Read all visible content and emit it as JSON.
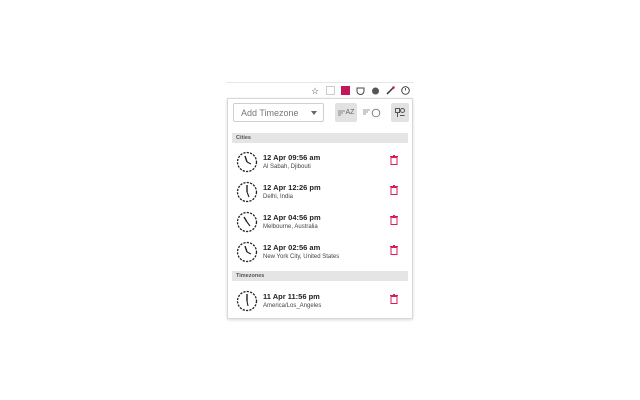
{
  "toolbar": {
    "add_timezone_placeholder": "Add Timezone",
    "sort_az_label": "AZ"
  },
  "sections": {
    "cities_label": "Cities",
    "timezones_label": "Timezones"
  },
  "cities": [
    {
      "time": "12 Apr 09:56 am",
      "place": "Al Sabah, Djibouti"
    },
    {
      "time": "12 Apr 12:26 pm",
      "place": "Delhi, India"
    },
    {
      "time": "12 Apr 04:56 pm",
      "place": "Melbourne, Australia"
    },
    {
      "time": "12 Apr 02:56 am",
      "place": "New York City, United States"
    }
  ],
  "timezones": [
    {
      "time": "11 Apr 11:56 pm",
      "place": "America/Los_Angeles"
    }
  ],
  "colors": {
    "delete": "#d81b60",
    "header_bg": "#e5e5e5"
  }
}
